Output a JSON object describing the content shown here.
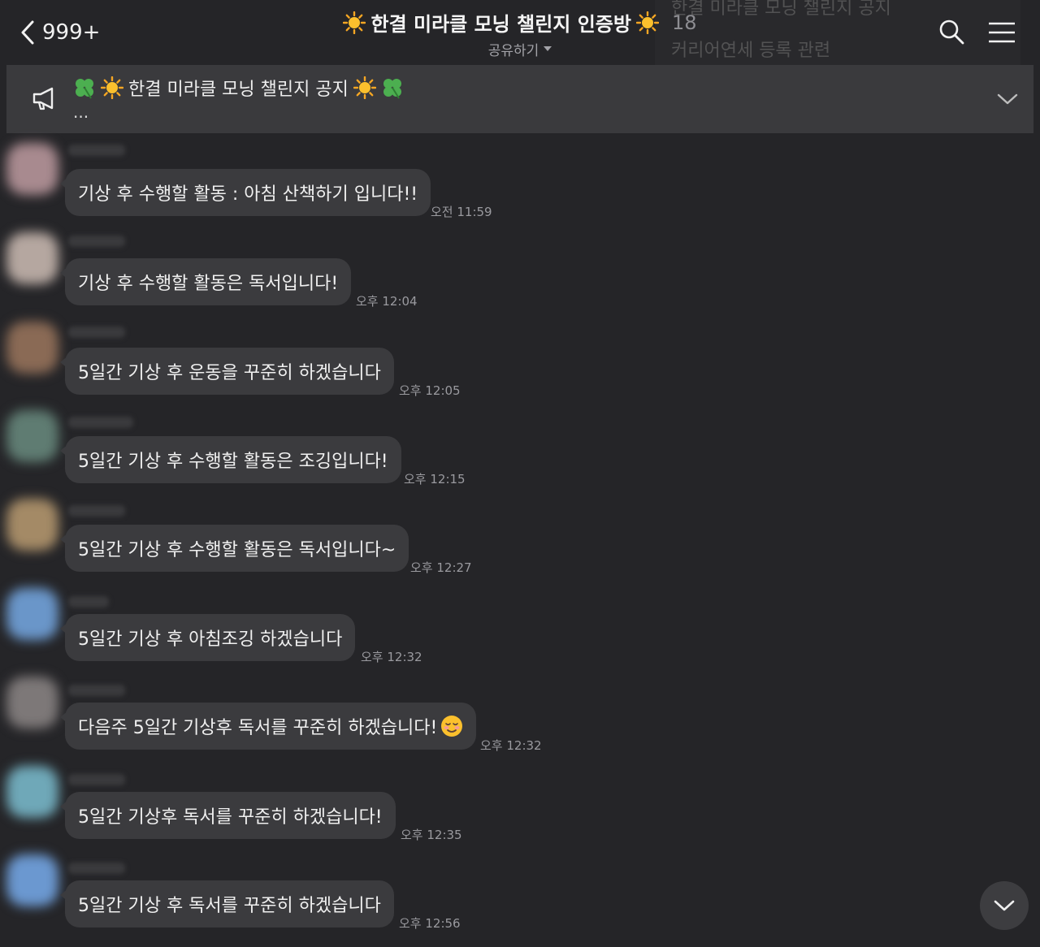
{
  "header": {
    "back_count": "999+",
    "title": "한결 미라클 모닝 챌린지 인증방",
    "member_count": "18",
    "share_label": "공유하기",
    "ghost_notice_line1": "한결 미라클 모닝 챌린지 공지",
    "ghost_notice_line2": "커리어연세 등록 관련"
  },
  "notice": {
    "text": "한결 미라클 모닝 챌린지 공지",
    "more": "..."
  },
  "messages": [
    {
      "text": "기상 후 수행할 활동 : 아침 산책하기 입니다!!",
      "time": "오전 11:59",
      "avatar_color": "#a88a8f"
    },
    {
      "text": "기상 후 수행할 활동은 독서입니다!",
      "time": "오후 12:04",
      "avatar_color": "#b5a7a0"
    },
    {
      "text": "5일간 기상 후 운동을 꾸준히 하겠습니다",
      "time": "오후 12:05",
      "avatar_color": "#8a6a55"
    },
    {
      "text": "5일간 기상 후 수행할 활동은 조깅입니다!",
      "time": "오후 12:15",
      "avatar_color": "#5f7c72"
    },
    {
      "text": "5일간 기상 후 수행할 활동은 독서입니다~",
      "time": "오후 12:27",
      "avatar_color": "#a48a66"
    },
    {
      "text": "5일간 기상 후 아침조깅 하겠습니다",
      "time": "오후 12:32",
      "avatar_color": "#6a96c9"
    },
    {
      "text": "다음주 5일간 기상후 독서를 꾸준히 하겠습니다!",
      "time": "오후 12:32",
      "avatar_color": "#7d7878",
      "emoji": "relieved-smile-emoji"
    },
    {
      "text": "5일간 기상후 독서를 꾸준히 하겠습니다!",
      "time": "오후 12:35",
      "avatar_color": "#6fa8b8"
    },
    {
      "text": "5일간 기상 후 독서를 꾸준히 하겠습니다",
      "time": "오후 12:56",
      "avatar_color": "#6b98d0"
    }
  ],
  "icons": {
    "back": "chevron-left-icon",
    "search": "search-icon",
    "menu": "hamburger-menu-icon",
    "notice": "megaphone-icon",
    "expand": "chevron-down-icon",
    "scroll": "chevron-down-icon"
  },
  "colors": {
    "background": "#252528",
    "bubble": "#3b3b3e",
    "notice_bar": "#3a3a3d"
  }
}
